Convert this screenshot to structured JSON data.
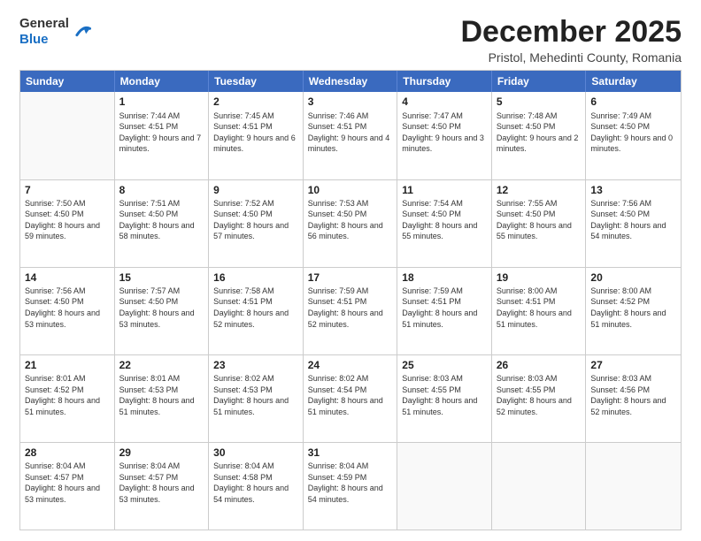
{
  "logo": {
    "general": "General",
    "blue": "Blue"
  },
  "title": "December 2025",
  "location": "Pristol, Mehedinti County, Romania",
  "days_of_week": [
    "Sunday",
    "Monday",
    "Tuesday",
    "Wednesday",
    "Thursday",
    "Friday",
    "Saturday"
  ],
  "weeks": [
    [
      {
        "day": "",
        "empty": true
      },
      {
        "day": "1",
        "sunrise": "7:44 AM",
        "sunset": "4:51 PM",
        "daylight": "9 hours and 7 minutes."
      },
      {
        "day": "2",
        "sunrise": "7:45 AM",
        "sunset": "4:51 PM",
        "daylight": "9 hours and 6 minutes."
      },
      {
        "day": "3",
        "sunrise": "7:46 AM",
        "sunset": "4:51 PM",
        "daylight": "9 hours and 4 minutes."
      },
      {
        "day": "4",
        "sunrise": "7:47 AM",
        "sunset": "4:50 PM",
        "daylight": "9 hours and 3 minutes."
      },
      {
        "day": "5",
        "sunrise": "7:48 AM",
        "sunset": "4:50 PM",
        "daylight": "9 hours and 2 minutes."
      },
      {
        "day": "6",
        "sunrise": "7:49 AM",
        "sunset": "4:50 PM",
        "daylight": "9 hours and 0 minutes."
      }
    ],
    [
      {
        "day": "7",
        "sunrise": "7:50 AM",
        "sunset": "4:50 PM",
        "daylight": "8 hours and 59 minutes."
      },
      {
        "day": "8",
        "sunrise": "7:51 AM",
        "sunset": "4:50 PM",
        "daylight": "8 hours and 58 minutes."
      },
      {
        "day": "9",
        "sunrise": "7:52 AM",
        "sunset": "4:50 PM",
        "daylight": "8 hours and 57 minutes."
      },
      {
        "day": "10",
        "sunrise": "7:53 AM",
        "sunset": "4:50 PM",
        "daylight": "8 hours and 56 minutes."
      },
      {
        "day": "11",
        "sunrise": "7:54 AM",
        "sunset": "4:50 PM",
        "daylight": "8 hours and 55 minutes."
      },
      {
        "day": "12",
        "sunrise": "7:55 AM",
        "sunset": "4:50 PM",
        "daylight": "8 hours and 55 minutes."
      },
      {
        "day": "13",
        "sunrise": "7:56 AM",
        "sunset": "4:50 PM",
        "daylight": "8 hours and 54 minutes."
      }
    ],
    [
      {
        "day": "14",
        "sunrise": "7:56 AM",
        "sunset": "4:50 PM",
        "daylight": "8 hours and 53 minutes."
      },
      {
        "day": "15",
        "sunrise": "7:57 AM",
        "sunset": "4:50 PM",
        "daylight": "8 hours and 53 minutes."
      },
      {
        "day": "16",
        "sunrise": "7:58 AM",
        "sunset": "4:51 PM",
        "daylight": "8 hours and 52 minutes."
      },
      {
        "day": "17",
        "sunrise": "7:59 AM",
        "sunset": "4:51 PM",
        "daylight": "8 hours and 52 minutes."
      },
      {
        "day": "18",
        "sunrise": "7:59 AM",
        "sunset": "4:51 PM",
        "daylight": "8 hours and 51 minutes."
      },
      {
        "day": "19",
        "sunrise": "8:00 AM",
        "sunset": "4:51 PM",
        "daylight": "8 hours and 51 minutes."
      },
      {
        "day": "20",
        "sunrise": "8:00 AM",
        "sunset": "4:52 PM",
        "daylight": "8 hours and 51 minutes."
      }
    ],
    [
      {
        "day": "21",
        "sunrise": "8:01 AM",
        "sunset": "4:52 PM",
        "daylight": "8 hours and 51 minutes."
      },
      {
        "day": "22",
        "sunrise": "8:01 AM",
        "sunset": "4:53 PM",
        "daylight": "8 hours and 51 minutes."
      },
      {
        "day": "23",
        "sunrise": "8:02 AM",
        "sunset": "4:53 PM",
        "daylight": "8 hours and 51 minutes."
      },
      {
        "day": "24",
        "sunrise": "8:02 AM",
        "sunset": "4:54 PM",
        "daylight": "8 hours and 51 minutes."
      },
      {
        "day": "25",
        "sunrise": "8:03 AM",
        "sunset": "4:55 PM",
        "daylight": "8 hours and 51 minutes."
      },
      {
        "day": "26",
        "sunrise": "8:03 AM",
        "sunset": "4:55 PM",
        "daylight": "8 hours and 52 minutes."
      },
      {
        "day": "27",
        "sunrise": "8:03 AM",
        "sunset": "4:56 PM",
        "daylight": "8 hours and 52 minutes."
      }
    ],
    [
      {
        "day": "28",
        "sunrise": "8:04 AM",
        "sunset": "4:57 PM",
        "daylight": "8 hours and 53 minutes."
      },
      {
        "day": "29",
        "sunrise": "8:04 AM",
        "sunset": "4:57 PM",
        "daylight": "8 hours and 53 minutes."
      },
      {
        "day": "30",
        "sunrise": "8:04 AM",
        "sunset": "4:58 PM",
        "daylight": "8 hours and 54 minutes."
      },
      {
        "day": "31",
        "sunrise": "8:04 AM",
        "sunset": "4:59 PM",
        "daylight": "8 hours and 54 minutes."
      },
      {
        "day": "",
        "empty": true
      },
      {
        "day": "",
        "empty": true
      },
      {
        "day": "",
        "empty": true
      }
    ]
  ]
}
